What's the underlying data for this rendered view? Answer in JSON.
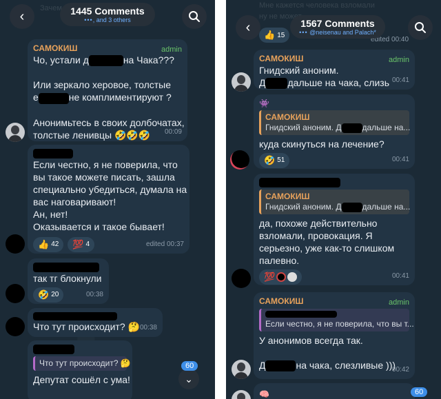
{
  "left": {
    "header": {
      "title": "1445 Comments",
      "subtitle": ", and 3 others",
      "subtitle_dots": "•••"
    },
    "ghost_text": "Зачем",
    "messages": [
      {
        "sender": "САМОКИШ",
        "badge": "admin",
        "line1a": "Чо, устали д",
        "line1b": "на Чака???",
        "line2": "Или зеркало херовое, толстые",
        "line3a": "е",
        "line3b": "не комплиментируют ?",
        "line4": "Анонимьтесь в своих долбочатах,",
        "line5": "толстые ленивцы 🤣🤣🤣",
        "time": "00:09"
      },
      {
        "lines": [
          "Если честно, я не поверила, что",
          "вы такое можете писать, зашла",
          "специально убедиться, думала на",
          "вас наговаривают!",
          "Ан, нет!",
          "Оказывается и такое бывает!"
        ],
        "reactions": [
          {
            "emoji": "👍",
            "count": "42"
          },
          {
            "emoji": "💯",
            "count": "4"
          }
        ],
        "time": "edited 00:37"
      },
      {
        "text": "так тг блокнули",
        "reactions": [
          {
            "emoji": "🤣",
            "count": "20"
          }
        ],
        "time": "00:38"
      },
      {
        "text": "Что тут происходит? 🤔",
        "time": "00:38"
      },
      {
        "quote": "Что тут происходит? 🤔",
        "text": "Депутат сошёл с ума!"
      }
    ],
    "unread_badge": "60",
    "scroll_icon": "chevron-down-icon"
  },
  "right": {
    "header": {
      "title": "1567 Comments",
      "subtitle": "@neisenau and Palach*",
      "subtitle_dots": "•••"
    },
    "ghost_text_1": "Мне кажется человека взломали",
    "ghost_text_2": "ну не может",
    "top_reaction": {
      "emoji": "👍",
      "count": "15"
    },
    "top_time": "edited 00:40",
    "messages": [
      {
        "sender": "САМОКИШ",
        "badge": "admin",
        "line1": "Гнидский аноним.",
        "line2a": "Д",
        "line2b": "дальше на чака, слизь",
        "time": "00:41"
      },
      {
        "quote_sender": "САМОКИШ",
        "quote_a": "Гнидский аноним. Д",
        "quote_b": "дальше на...",
        "text": "куда скинуться на лечение?",
        "reactions": [
          {
            "emoji": "🤣",
            "count": "51"
          }
        ],
        "time": "00:41"
      },
      {
        "quote_sender": "САМОКИШ",
        "quote_a": "Гнидский аноним. Д",
        "quote_b": "дальше на...",
        "lines": [
          "да, похоже действительно",
          "взломали, провокация. Я",
          "серьезно, уже как-то слишком",
          "палевно."
        ],
        "reactions": [
          {
            "emoji": "💯",
            "count": ""
          }
        ],
        "time": "00:41"
      },
      {
        "sender": "САМОКИШ",
        "badge": "admin",
        "quote": "Если честно, я не поверила, что вы т...",
        "line1": "У анонимов всегда так.",
        "line2a": "Д",
        "line2b": "на чака, слезливые )))",
        "time": "00:42"
      }
    ],
    "unread_badge": "60"
  },
  "colors": {
    "panel_bg": "#1b2a36",
    "bubble_bg": "#223444",
    "admin_name": "#e8a25b",
    "admin_badge": "#6ac46a",
    "link_blue": "#6fb0ff",
    "badge_blue": "#3d8ee8"
  }
}
